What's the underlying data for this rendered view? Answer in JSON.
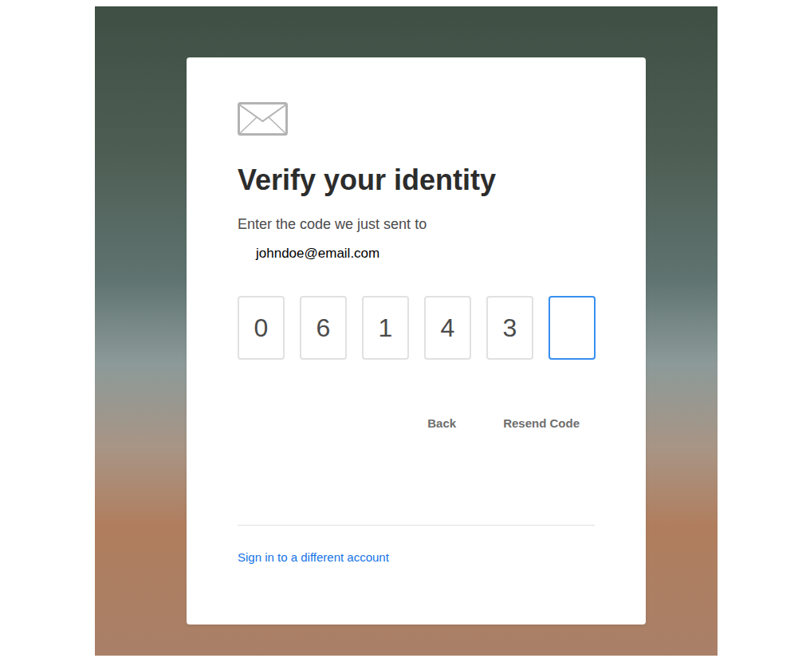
{
  "title": "Verify your identity",
  "instruction": "Enter the code we just sent to",
  "email": "johndoe@email.com",
  "code": [
    {
      "digit": "0",
      "focused": false
    },
    {
      "digit": "6",
      "focused": false
    },
    {
      "digit": "1",
      "focused": false
    },
    {
      "digit": "4",
      "focused": false
    },
    {
      "digit": "3",
      "focused": false
    },
    {
      "digit": "",
      "focused": true
    }
  ],
  "actions": [
    "Back",
    "Resend Code"
  ],
  "link": "Sign in to a different account"
}
